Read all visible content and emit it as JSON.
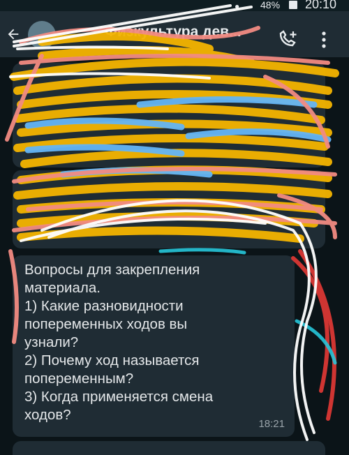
{
  "status_bar": {
    "battery_percent": "48%",
    "time": "20:10"
  },
  "header": {
    "title": "Физкультура дев...",
    "icons": [
      "back-arrow-icon",
      "avatar",
      "add-call-icon",
      "more-vert-icon"
    ]
  },
  "messages": [
    {
      "text": "Вопросы для закрепления\nматериала.\n1) Какие разновидности\nпопеременных ходов вы\nузнали?\n2) Почему ход называется\nпопеременным?\n3) Когда применяется смена\nходов?",
      "time": "18:21"
    }
  ],
  "colors": {
    "app_bar": "#1f2c34",
    "background": "#0b1418",
    "bubble": "#1f2c34",
    "scribble_yellow": "#f4b400",
    "scribble_pink": "#f28b82",
    "scribble_blue": "#64b5f6",
    "scribble_white": "#ffffff",
    "scribble_red": "#e53935",
    "scribble_cyan": "#26c6da"
  }
}
